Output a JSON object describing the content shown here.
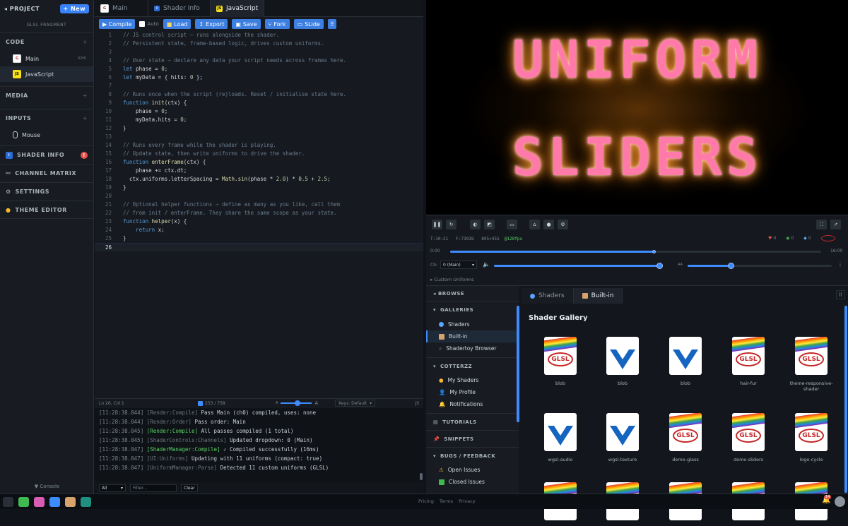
{
  "sidebar": {
    "project_label": "◂ PROJECT",
    "new_label": "+ New",
    "subtitle": "GLSL FRAGMENT",
    "sections": {
      "code": "CODE",
      "media": "MEDIA",
      "inputs": "INPUTS",
      "shader_info": "SHADER INFO",
      "channel_matrix": "CHANNEL MATRIX",
      "settings": "SETTINGS",
      "theme_editor": "THEME EDITOR",
      "console": "▼ Console"
    },
    "code_items": [
      {
        "label": "Main",
        "badge": "ICH0"
      },
      {
        "label": "JavaScript"
      }
    ],
    "input_items": [
      {
        "label": "Mouse"
      }
    ],
    "shader_info_alert": "!"
  },
  "editor": {
    "tabs": [
      {
        "label": "Main"
      },
      {
        "label": "Shader Info"
      },
      {
        "label": "JavaScript"
      }
    ],
    "toolbar": {
      "compile": "▶ Compile",
      "auto": "Auto",
      "load": "Load",
      "export": "Export",
      "save": "Save",
      "fork": "Fork",
      "slide": "SLide",
      "more": "⠿"
    },
    "status": {
      "position": "Ln 26, Col 1",
      "chars": "253 / 758",
      "font_small": "A",
      "font_large": "A",
      "keys": "Keys: Default",
      "lang": "JS"
    }
  },
  "code_lines": [
    {
      "n": "1",
      "html": "<span class='cm'>// JS control script — runs alongside the shader.</span>"
    },
    {
      "n": "2",
      "html": "<span class='cm'>// Persistent state, frame-based logic, drives custom uniforms.</span>"
    },
    {
      "n": "3",
      "html": ""
    },
    {
      "n": "4",
      "html": "<span class='cm'>// User state — declare any data your script needs across frames here.</span>"
    },
    {
      "n": "5",
      "html": "<span class='kw'>let</span> <span class='tx'>phase = </span><span class='num'>0</span><span class='tx'>;</span>"
    },
    {
      "n": "6",
      "html": "<span class='kw'>let</span> <span class='tx'>myData = { hits: </span><span class='num'>0</span><span class='tx'> };</span>"
    },
    {
      "n": "7",
      "html": ""
    },
    {
      "n": "8",
      "html": "<span class='cm'>// Runs once when the script (re)loads. Reset / initialise state here.</span>"
    },
    {
      "n": "9",
      "html": "<span class='kw'>function</span> <span class='fn'>init</span><span class='tx'>(ctx) {</span>"
    },
    {
      "n": "10",
      "html": "<span class='tx'>    phase = </span><span class='num'>0</span><span class='tx'>;</span>"
    },
    {
      "n": "11",
      "html": "<span class='tx'>    myData.hits = </span><span class='num'>0</span><span class='tx'>;</span>"
    },
    {
      "n": "12",
      "html": "<span class='tx'>}</span>"
    },
    {
      "n": "13",
      "html": ""
    },
    {
      "n": "14",
      "html": "<span class='cm'>// Runs every frame while the shader is playing.</span>"
    },
    {
      "n": "15",
      "html": "<span class='cm'>// Update state, then write uniforms to drive the shader.</span>"
    },
    {
      "n": "16",
      "html": "<span class='kw'>function</span> <span class='fn'>enterFrame</span><span class='tx'>(ctx) {</span>"
    },
    {
      "n": "17",
      "html": "<span class='tx'>    phase += ctx.dt;</span>"
    },
    {
      "n": "18",
      "html": "<span class='tx'>  ctx.uniforms.letterSpacing = </span><span class='fn'>Math</span><span class='tx'>.</span><span class='fn'>sin</span><span class='tx'>(phase * </span><span class='num'>2.0</span><span class='tx'>) * </span><span class='num'>0.5</span><span class='tx'> + </span><span class='num'>2.5</span><span class='tx'>;</span>"
    },
    {
      "n": "19",
      "html": "<span class='tx'>}</span>"
    },
    {
      "n": "20",
      "html": ""
    },
    {
      "n": "21",
      "html": "<span class='cm'>// Optional helper functions — define as many as you like, call them</span>"
    },
    {
      "n": "22",
      "html": "<span class='cm'>// from init / enterFrame. They share the same scope as your state.</span>"
    },
    {
      "n": "23",
      "html": "<span class='kw'>function</span> <span class='fn'>helper</span><span class='tx'>(x) {</span>"
    },
    {
      "n": "24",
      "html": "<span class='kw'>    return</span><span class='tx'> x;</span>"
    },
    {
      "n": "25",
      "html": "<span class='tx'>}</span>"
    },
    {
      "n": "26",
      "html": ""
    }
  ],
  "console": {
    "lines": [
      {
        "time": "[11:28:38.044]",
        "tag": "[Render:Compile]",
        "msg": " Pass Main (ch0) compiled, uses: none",
        "green": false
      },
      {
        "time": "[11:28:38.044]",
        "tag": "[Render:Order]",
        "msg": " Pass order: Main",
        "green": false
      },
      {
        "time": "[11:28:38.045]",
        "tag": "[Render:Compile]",
        "msg": " All passes compiled (1 total)",
        "green": true
      },
      {
        "time": "[11:28:38.045]",
        "tag": "[ShaderControls:Channels]",
        "msg": " Updated dropdown: 0 (Main)",
        "green": false
      },
      {
        "time": "[11:28:38.047]",
        "tag": "[ShaderManager:Compile]",
        "msg": " ✓ Compiled successfully (16ms)",
        "green": true
      },
      {
        "time": "[11:28:38.047]",
        "tag": "[UI:Uniforms]",
        "msg": " Updating with 11 uniforms (compact: true)",
        "green": false
      },
      {
        "time": "[11:28:38.047]",
        "tag": "[UniformManager:Parse]",
        "msg": " Detected 11 custom uniforms (GLSL)",
        "green": false
      }
    ],
    "filter_select": "All",
    "filter_placeholder": "Filter...",
    "clear_label": "Clear"
  },
  "preview": {
    "line1": "UNIFORM",
    "line2": "SLIDERS"
  },
  "controls": {
    "time": "T:10:21",
    "frame": "F:73938",
    "resolution": "895×455",
    "fps": "@120fps",
    "start_time": "0:00",
    "end_time": "16:00",
    "timeline_progress": 0.55,
    "channel_label": "Ch:",
    "channel_value": "0 (Main)",
    "volume_level": 0.99,
    "aa_label": "AA",
    "aa_level": 0.3,
    "custom_uniforms": "▸ Custom Uniforms",
    "counters": [
      "0",
      "0",
      "0"
    ]
  },
  "browser": {
    "browse_label": "◂ BROWSE",
    "galleries_label": "GALLERIES",
    "gallery_items": [
      {
        "label": "Shaders"
      },
      {
        "label": "Built-in"
      },
      {
        "label": "Shadertoy Browser"
      }
    ],
    "user_label": "COTTERZZ",
    "user_items": [
      {
        "label": "My Shaders"
      },
      {
        "label": "My Profile"
      },
      {
        "label": "Notifications"
      }
    ],
    "tutorials_label": "TUTORIALS",
    "snippets_label": "SNIPPETS",
    "bugs_label": "BUGS / FEEDBACK",
    "bug_items": [
      {
        "label": "Open Issues"
      },
      {
        "label": "Closed Issues"
      }
    ],
    "tabs": [
      {
        "label": "Shaders"
      },
      {
        "label": "Built-in"
      }
    ],
    "gallery_title": "Shader Gallery",
    "cards": [
      {
        "name": "blob",
        "kind": "glsl"
      },
      {
        "name": "blob",
        "kind": "wgsl"
      },
      {
        "name": "blob",
        "kind": "wgsl2"
      },
      {
        "name": "hair-fur",
        "kind": "glsl"
      },
      {
        "name": "theme-responsive-shader",
        "kind": "glsl"
      },
      {
        "name": "wgsl-audio",
        "kind": "wgsl"
      },
      {
        "name": "wgsl-texture",
        "kind": "wgsl"
      },
      {
        "name": "demo-glass",
        "kind": "glsl"
      },
      {
        "name": "demo-sliders",
        "kind": "glsl"
      },
      {
        "name": "logo-cycle",
        "kind": "glsl"
      }
    ]
  },
  "footer": {
    "pricing": "Pricing",
    "terms": "Terms",
    "privacy": "Privacy",
    "notif_count": "14"
  }
}
